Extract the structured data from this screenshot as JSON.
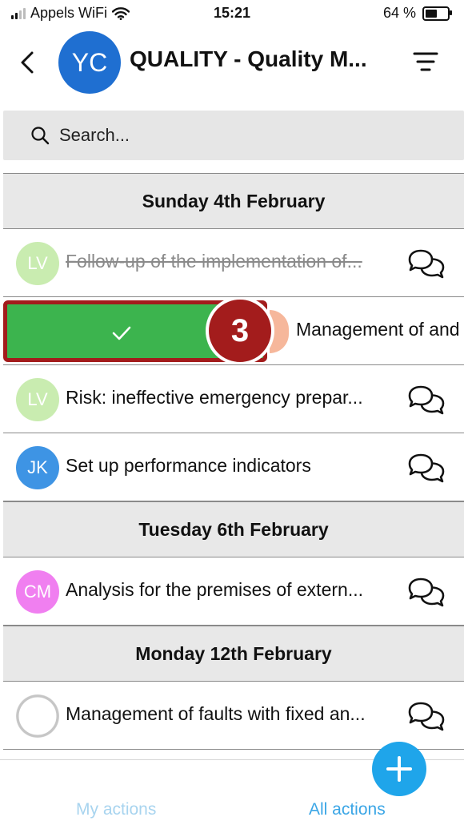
{
  "status_bar": {
    "carrier": "Appels WiFi",
    "time": "15:21",
    "battery_percent": "64 %",
    "battery_level": 0.64
  },
  "header": {
    "avatar_initials": "YC",
    "avatar_color": "#1f6fd1",
    "title": "QUALITY - Quality M...",
    "back_icon": "chevron-left-icon",
    "filter_icon": "filter-lines-icon"
  },
  "search": {
    "placeholder": "Search..."
  },
  "sections": [
    {
      "date": "Sunday 4th February",
      "rows": [
        {
          "initials": "LV",
          "color": "#c9ecb0",
          "text": "Follow-up of the implementation of...",
          "completed": true
        },
        {
          "initials": "",
          "color": "#f6b79b",
          "text": "Management of and",
          "swiped": true,
          "step_badge": "3",
          "swipe_color": "#3cb44e"
        },
        {
          "initials": "LV",
          "color": "#c9ecb0",
          "text": "Risk: ineffective emergency prepar..."
        },
        {
          "initials": "JK",
          "color": "#3e94e4",
          "text": "Set up performance indicators"
        }
      ]
    },
    {
      "date": "Tuesday 6th February",
      "rows": [
        {
          "initials": "CM",
          "color": "#f07ff0",
          "text": "Analysis for the premises of extern..."
        }
      ]
    },
    {
      "date": "Monday 12th February",
      "rows": [
        {
          "initials": "",
          "color": "#d8d8d8",
          "text": "Management of faults with fixed an...",
          "placeholder_avatar": true
        }
      ]
    }
  ],
  "tabs": {
    "my_actions": "My actions",
    "all_actions": "All actions"
  },
  "fab_icon": "plus-icon",
  "accent_color": "#1fa5ea"
}
